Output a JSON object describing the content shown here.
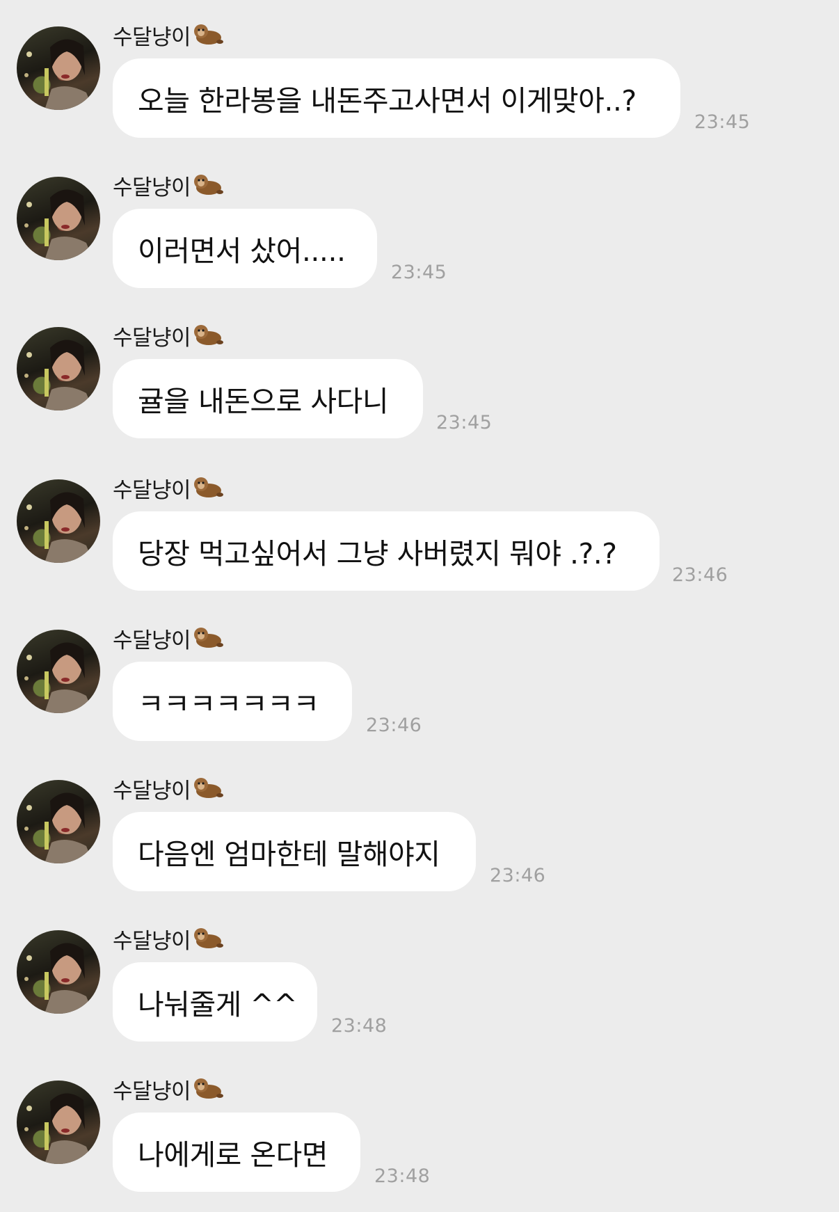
{
  "sender_name": "수달냥이",
  "sender_emoji": "otter-emoji",
  "colors": {
    "background": "#ececec",
    "bubble": "#ffffff",
    "timestamp": "#a0a0a0",
    "text": "#111111"
  },
  "messages": [
    {
      "text": "오늘 한라봉을 내돈주고사면서 이게맞아..?",
      "time": "23:45"
    },
    {
      "text": "이러면서 샀어.....",
      "time": "23:45"
    },
    {
      "text": "귤을 내돈으로 사다니",
      "time": "23:45"
    },
    {
      "text": "당장 먹고싶어서 그냥 사버렸지 뭐야 .?.?",
      "time": "23:46"
    },
    {
      "text": "ㅋㅋㅋㅋㅋㅋㅋ",
      "time": "23:46"
    },
    {
      "text": "다음엔 엄마한테 말해야지",
      "time": "23:46"
    },
    {
      "text": "나눠줄게 ^^",
      "time": "23:48"
    },
    {
      "text": "나에게로 온다면",
      "time": "23:48"
    }
  ]
}
